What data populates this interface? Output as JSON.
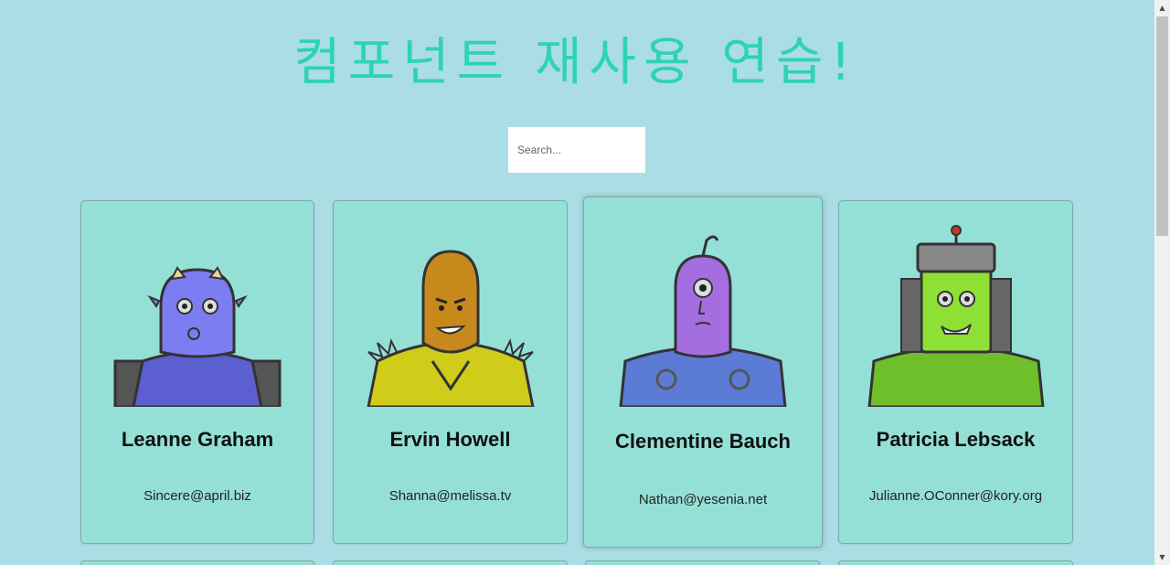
{
  "page": {
    "title": "컴포넌트 재사용 연습!"
  },
  "search": {
    "placeholder": "Search..."
  },
  "cards": [
    {
      "name": "Leanne Graham",
      "email": "Sincere@april.biz",
      "robot_color": "#7b7ef0"
    },
    {
      "name": "Ervin Howell",
      "email": "Shanna@melissa.tv",
      "robot_color": "#c8891c"
    },
    {
      "name": "Clementine Bauch",
      "email": "Nathan@yesenia.net",
      "robot_color": "#a56ee0"
    },
    {
      "name": "Patricia Lebsack",
      "email": "Julianne.OConner@kory.org",
      "robot_color": "#8fe034"
    }
  ],
  "colors": {
    "background": "#abdde4",
    "title": "#2ed3b4",
    "card": "#95e0d6"
  },
  "scrollbar": {
    "up_icon": "scroll-up-arrow-icon",
    "down_icon": "scroll-down-arrow-icon"
  }
}
